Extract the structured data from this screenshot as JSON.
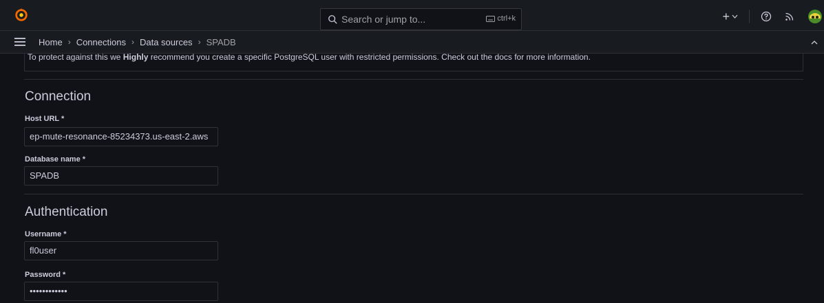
{
  "topbar": {
    "search_placeholder": "Search or jump to...",
    "shortcut": "ctrl+k",
    "new_label": "+",
    "icons": [
      "grafana-logo-icon",
      "search-icon",
      "keyboard-icon",
      "plus-icon",
      "help-icon",
      "news-rss-icon",
      "user-avatar"
    ]
  },
  "breadcrumb": {
    "items": [
      "Home",
      "Connections",
      "Data sources"
    ],
    "current": "SPADB"
  },
  "notice": {
    "text_before": "To protect against this we ",
    "bold": "Highly",
    "text_after": " recommend you create a specific PostgreSQL user with restricted permissions. Check out the docs for more information."
  },
  "connection": {
    "title": "Connection",
    "host_label": "Host URL *",
    "host_value": "ep-mute-resonance-85234373.us-east-2.aws",
    "db_label": "Database name *",
    "db_value": "SPADB"
  },
  "authentication": {
    "title": "Authentication",
    "username_label": "Username *",
    "username_value": "fl0user",
    "password_label": "Password *",
    "password_value": "••••••••••••"
  },
  "colors": {
    "background": "#111217",
    "bar": "#181b1f",
    "border": "#2c2f36",
    "text": "#ccccdc",
    "brand_orange": "#f46800"
  }
}
